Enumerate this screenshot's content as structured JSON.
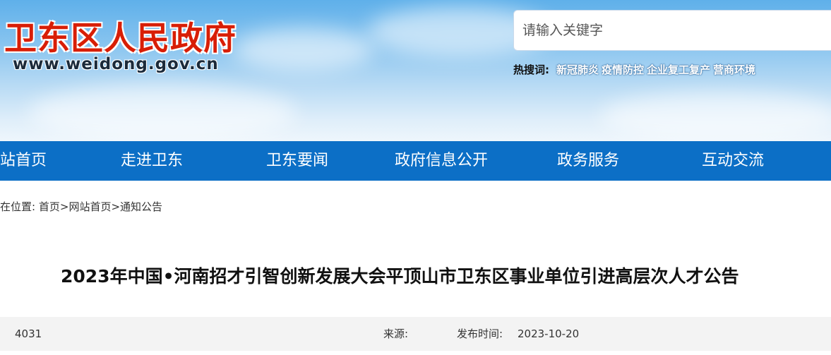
{
  "header": {
    "logo_title": "卫东区人民政府",
    "logo_url": "www.weidong.gov.cn",
    "search_placeholder": "请输入关键字",
    "hot_label": "热搜词:",
    "hot_words": [
      "新冠肺炎",
      "疫情防控",
      "企业复工复产",
      "营商环境"
    ]
  },
  "nav": {
    "items": [
      "站首页",
      "走进卫东",
      "卫东要闻",
      "政府信息公开",
      "政务服务",
      "互动交流"
    ]
  },
  "breadcrumb": {
    "prefix": "在位置:",
    "items": [
      "首页",
      "网站首页",
      "通知公告"
    ],
    "separator": ">"
  },
  "article": {
    "title": "2023年中国•河南招才引智创新发展大会平顶山市卫东区事业单位引进高层次人才公告",
    "views": "4031",
    "source_label": "来源:",
    "publish_label": "发布时间:",
    "publish_date": "2023-10-20"
  },
  "colors": {
    "nav_bg": "#0c6fc6",
    "logo_red": "#d81e06"
  }
}
